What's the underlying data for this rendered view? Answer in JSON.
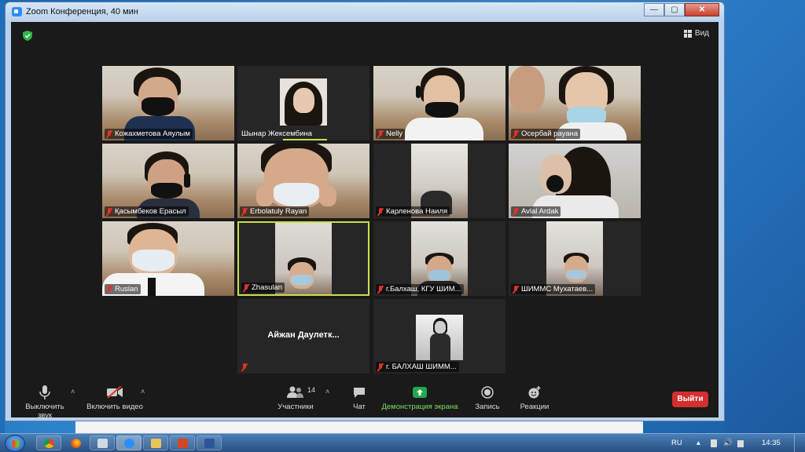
{
  "window": {
    "title": "Zoom Конференция, 40 мин",
    "controls": [
      "—",
      "▢",
      "✕"
    ]
  },
  "view_button": {
    "label": "Вид"
  },
  "participants": [
    {
      "name": "Кожахметова Аяулым"
    },
    {
      "name": "Шынар Жексембина"
    },
    {
      "name": "Nelly"
    },
    {
      "name": "Осербай рауана"
    },
    {
      "name": "Қасымбеков Ерасыл"
    },
    {
      "name": "Erbolatuly Rayan"
    },
    {
      "name": "Карленова Наиля"
    },
    {
      "name": "Avlal Ardak"
    },
    {
      "name": "Ruslan"
    },
    {
      "name": "Zhasulan"
    },
    {
      "name": "г.Балхаш, КГУ ШИМ..."
    },
    {
      "name": "ШИММС Мухатаев..."
    },
    {
      "name": "Айжан  Даулетк..."
    },
    {
      "name": "г. БАЛХАШ ШИММ..."
    }
  ],
  "toolbar": {
    "mute": "Выключить звук",
    "video": "Включить видео",
    "participants": "Участники",
    "participants_count": "14",
    "chat": "Чат",
    "share": "Демонстрация экрана",
    "record": "Запись",
    "reactions": "Реакции",
    "leave": "Выйти"
  },
  "taskbar": {
    "language": "RU",
    "time": "14:35"
  },
  "colors": {
    "share_accent": "#7ddf64",
    "leave": "#d32f2f",
    "active_speaker_border": "#c9e04a"
  }
}
